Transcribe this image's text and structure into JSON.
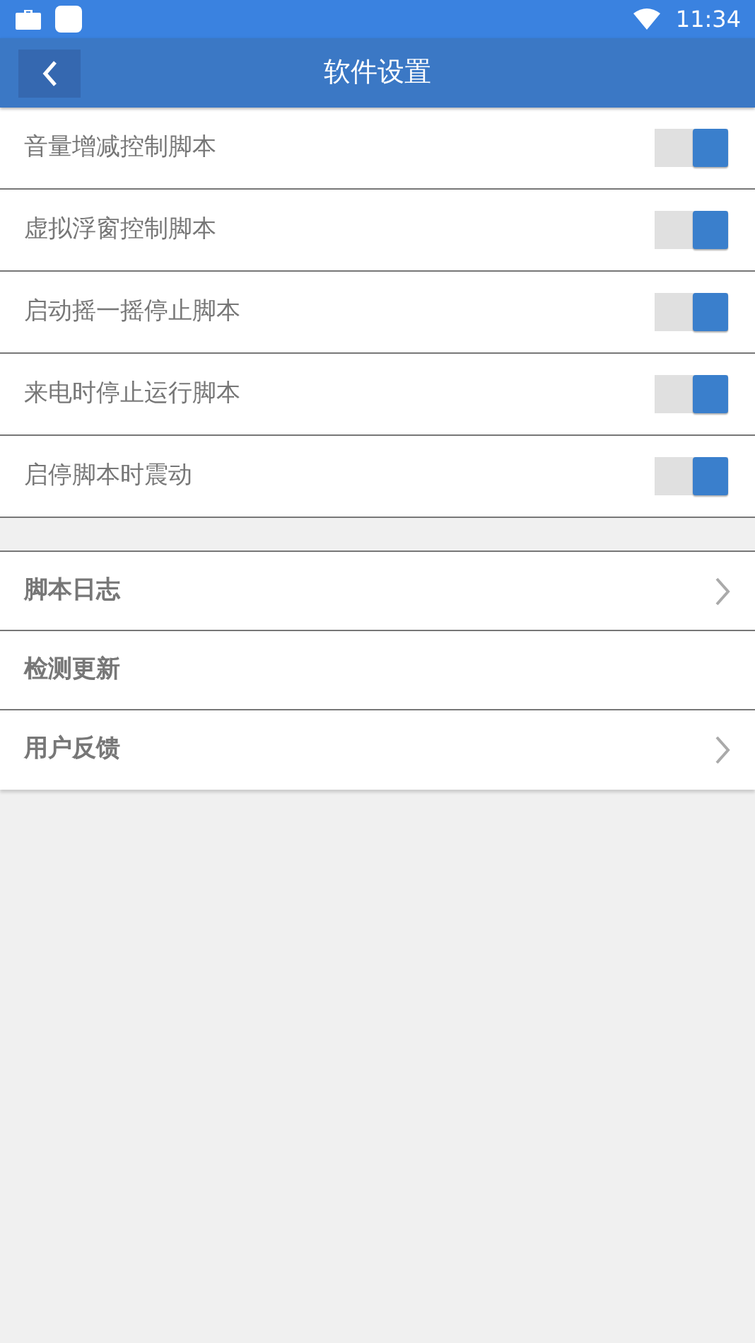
{
  "status_bar": {
    "time": "11:34"
  },
  "toolbar": {
    "title": "软件设置"
  },
  "switches": [
    {
      "label": "音量增减控制脚本",
      "on": true
    },
    {
      "label": "虚拟浮窗控制脚本",
      "on": true
    },
    {
      "label": "启动摇一摇停止脚本",
      "on": true
    },
    {
      "label": "来电时停止运行脚本",
      "on": true
    },
    {
      "label": "启停脚本时震动",
      "on": true
    }
  ],
  "links": [
    {
      "label": "脚本日志",
      "arrow": true
    },
    {
      "label": "检测更新",
      "arrow": false
    },
    {
      "label": "用户反馈",
      "arrow": true
    }
  ]
}
